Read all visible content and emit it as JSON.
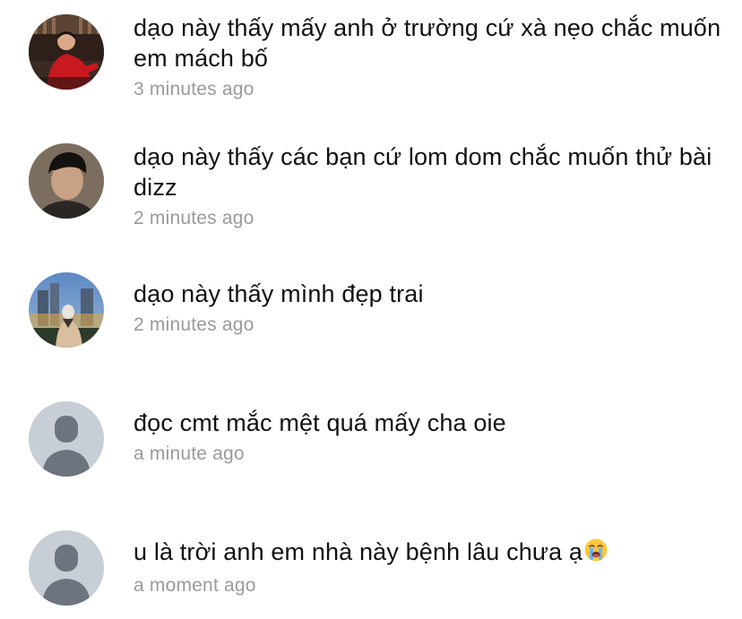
{
  "comments": [
    {
      "avatar_icon": "user-photo-icon",
      "text": "dạo này thấy mấy anh ở trường cứ xà nẹo chắc muốn em mách bố",
      "time": "3 minutes ago"
    },
    {
      "avatar_icon": "user-photo-icon",
      "text": "dạo này thấy các bạn cứ lom dom chắc muốn thử bài dizz",
      "time": "2 minutes ago"
    },
    {
      "avatar_icon": "user-photo-icon",
      "text": "dạo này thấy mình đẹp trai",
      "time": "2 minutes ago"
    },
    {
      "avatar_icon": "default-avatar-icon",
      "text": "đọc cmt mắc mệt quá mấy cha oie",
      "time": "a minute ago"
    },
    {
      "avatar_icon": "default-avatar-icon",
      "text": "u là trời anh em nhà này bệnh lâu chưa ạ",
      "emoji": "crying-face-emoji",
      "time": "a moment ago"
    }
  ],
  "colors": {
    "text": "#111111",
    "timestamp": "#9a9a9a",
    "default_avatar_bg": "#c8ced6",
    "default_avatar_fg": "#6c757f"
  }
}
